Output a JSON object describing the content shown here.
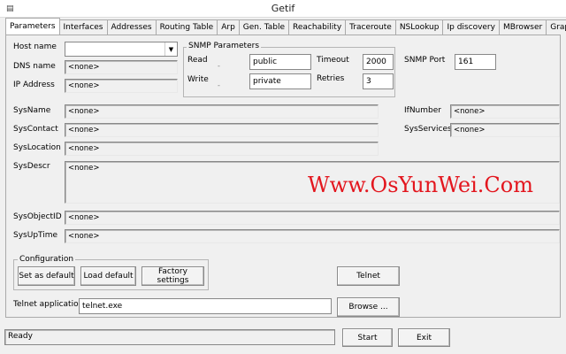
{
  "window": {
    "title": "Getif",
    "icon": "app-icon"
  },
  "tabs": [
    {
      "label": "Parameters",
      "active": true
    },
    {
      "label": "Interfaces"
    },
    {
      "label": "Addresses"
    },
    {
      "label": "Routing Table"
    },
    {
      "label": "Arp"
    },
    {
      "label": "Gen. Table"
    },
    {
      "label": "Reachability"
    },
    {
      "label": "Traceroute"
    },
    {
      "label": "NSLookup"
    },
    {
      "label": "Ip discovery"
    },
    {
      "label": "MBrowser"
    },
    {
      "label": "Graph"
    }
  ],
  "host": {
    "hostname_label": "Host name",
    "hostname_value": "",
    "dns_label": "DNS name",
    "dns_value": "<none>",
    "ip_label": "IP Address",
    "ip_value": "<none>"
  },
  "snmp": {
    "group_label": "SNMP Parameters",
    "read_label": "Read",
    "read_value": "public",
    "write_label": "Write",
    "write_value": "private",
    "timeout_label": "Timeout",
    "timeout_value": "2000",
    "retries_label": "Retries",
    "retries_value": "3",
    "port_label": "SNMP Port",
    "port_value": "161"
  },
  "sys": {
    "name_label": "SysName",
    "name_value": "<none>",
    "contact_label": "SysContact",
    "contact_value": "<none>",
    "location_label": "SysLocation",
    "location_value": "<none>",
    "descr_label": "SysDescr",
    "descr_value": "<none>",
    "objectid_label": "SysObjectID",
    "objectid_value": "<none>",
    "uptime_label": "SysUpTime",
    "uptime_value": "<none>",
    "ifnumber_label": "IfNumber",
    "ifnumber_value": "<none>",
    "services_label": "SysServices",
    "services_value": "<none>"
  },
  "config": {
    "group_label": "Configuration",
    "set_default": "Set as default",
    "load_default": "Load default",
    "factory": "Factory settings"
  },
  "telnet": {
    "button": "Telnet",
    "app_label": "Telnet application",
    "app_value": "telnet.exe",
    "browse": "Browse ..."
  },
  "footer": {
    "status": "Ready",
    "start": "Start",
    "exit": "Exit"
  },
  "watermark": "Www.OsYunWei.Com",
  "colors": {
    "watermark": "#e3161e"
  }
}
